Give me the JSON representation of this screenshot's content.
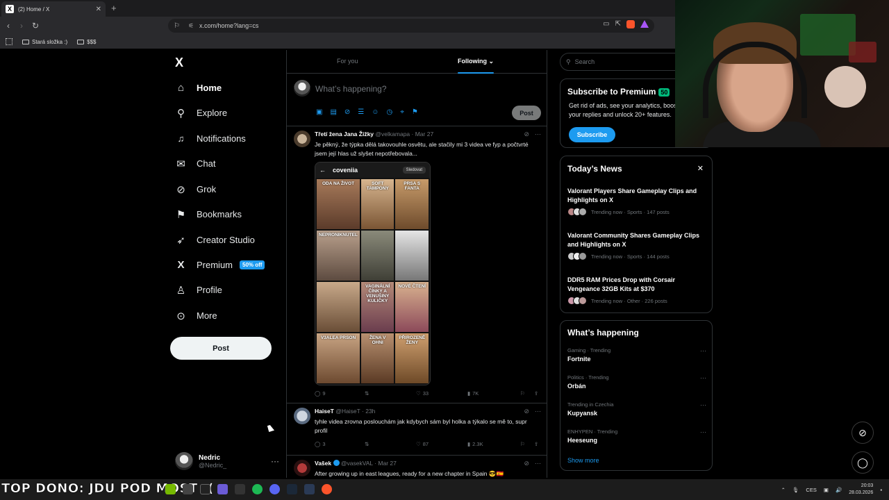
{
  "browser": {
    "tab_title": "(2) Home / X",
    "tab_favicon": "X",
    "url": "x.com/home?lang=cs",
    "bookmarks": [
      "Stará složka :)",
      "$$$"
    ]
  },
  "nav": {
    "logo": "X",
    "items": [
      {
        "label": "Home",
        "icon": "home-icon",
        "glyph": "⌂"
      },
      {
        "label": "Explore",
        "icon": "search-icon",
        "glyph": "⚲"
      },
      {
        "label": "Notifications",
        "icon": "bell-icon",
        "glyph": "🔔"
      },
      {
        "label": "Chat",
        "icon": "mail-icon",
        "glyph": "✉"
      },
      {
        "label": "Grok",
        "icon": "grok-icon",
        "glyph": "⊘"
      },
      {
        "label": "Bookmarks",
        "icon": "bookmark-icon",
        "glyph": "⚑"
      },
      {
        "label": "Creator Studio",
        "icon": "rocket-icon",
        "glyph": "➶"
      },
      {
        "label": "Premium",
        "icon": "x-icon",
        "glyph": "𝕏"
      },
      {
        "label": "Profile",
        "icon": "person-icon",
        "glyph": "♙"
      },
      {
        "label": "More",
        "icon": "more-circle-icon",
        "glyph": "⊙"
      }
    ],
    "premium_badge": "50% off",
    "post_label": "Post",
    "user": {
      "name": "Nedric",
      "handle": "@Nedric_",
      "more": "···"
    }
  },
  "feed": {
    "tabs": {
      "for_you": "For you",
      "following": "Following ⌄"
    },
    "composer": {
      "placeholder": "What’s happening?",
      "post_label": "Post"
    },
    "tweets": [
      {
        "name": "Třetí žena Jana Žižky",
        "handle": "@velkamapa",
        "time": "· Mar 27",
        "text": "Je pěkný, že týpka dělá takovouhle osvětu, ale stačily mi 3 videa ve fyp a počtvrté jsem její hlas už slyšet nepotřebovala...",
        "replies": "9",
        "reposts": "",
        "likes": "33",
        "views": "7K"
      },
      {
        "name": "HaiseT",
        "handle": "@HaiseT",
        "time": "· 23h",
        "text": "tyhle videa zrovna poslouchám jak kdybych sám byl holka a týkalo se mě to, supr profil",
        "replies": "3",
        "reposts": "",
        "likes": "87",
        "views": "2.3K"
      },
      {
        "name": "Vašek",
        "handle": "@vasekVAL",
        "time": "· Mar 27",
        "text": "After growing up in east leagues, ready for a new chapter in Spain 😎🇪🇸"
      }
    ],
    "embed": {
      "profile": "coveniia",
      "follow": "Sledovat",
      "thumbs": [
        "ODA NA ŽIVOT",
        "SOFT TAMPONY",
        "PRSA S FANTA",
        "NEPRONIKNUTEL",
        "",
        "",
        "",
        "VAGINÁLNÍ ČÍNKY A VENUŠINY KULIČKY",
        "NOVÉ ČTENÍ",
        "V3ALEA PRSON",
        "ŽENA V OHNI",
        "PŘIROZENĚ ŽENY"
      ]
    }
  },
  "right": {
    "search_placeholder": "Search",
    "premium": {
      "title": "Subscribe to Premium",
      "tag": "50",
      "text": "Get rid of ads, see your analytics, boost your replies and unlock 20+ features.",
      "button": "Subscribe"
    },
    "news": {
      "title": "Today’s News",
      "items": [
        {
          "title": "Valorant Players Share Gameplay Clips and Highlights on X",
          "meta": "Trending now · Sports · 147 posts"
        },
        {
          "title": "Valorant Community Shares Gameplay Clips and Highlights on X",
          "meta": "Trending now · Sports · 144 posts"
        },
        {
          "title": "DDR5 RAM Prices Drop with Corsair Vengeance 32GB Kits at $370",
          "meta": "Trending now · Other · 226 posts"
        }
      ]
    },
    "happening": {
      "title": "What’s happening",
      "items": [
        {
          "meta": "Gaming · Trending",
          "name": "Fortnite"
        },
        {
          "meta": "Politics · Trending",
          "name": "Orbán"
        },
        {
          "meta": "Trending in Czechia",
          "name": "Kupyansk"
        },
        {
          "meta": "ENHYPEN · Trending",
          "name": "Heeseung"
        }
      ],
      "show_more": "Show more"
    }
  },
  "taskbar": {
    "overlay": "TOP DONO: JDU POD MOST :(",
    "lang": "CES",
    "time": "20:03",
    "date": "28.03.2026"
  }
}
